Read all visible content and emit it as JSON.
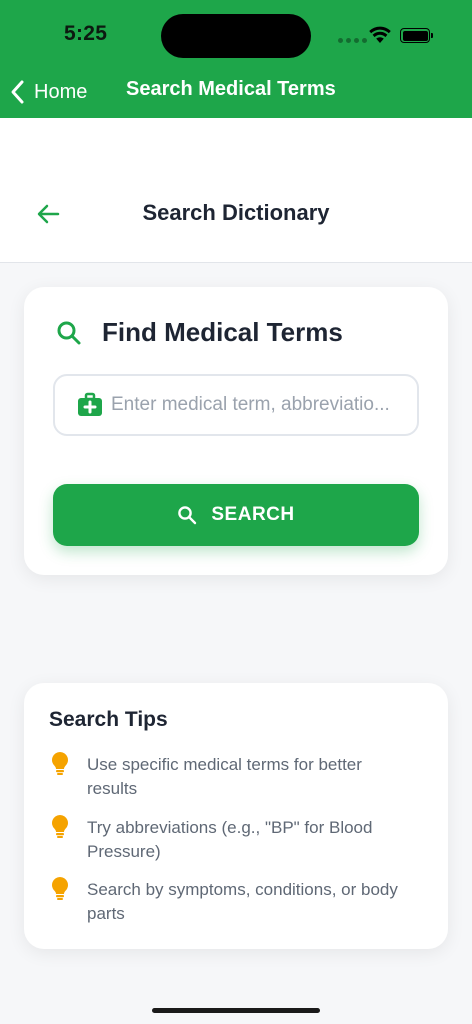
{
  "status_bar": {
    "time": "5:25"
  },
  "nav": {
    "back_label": "Home",
    "title": "Search Medical Terms"
  },
  "page": {
    "title": "Search Dictionary"
  },
  "search_card": {
    "title": "Find Medical Terms",
    "placeholder": "Enter medical term, abbreviatio...",
    "value": "",
    "button_label": "SEARCH"
  },
  "tips": {
    "title": "Search Tips",
    "items": [
      "Use specific medical terms for better results",
      "Try abbreviations (e.g., \"BP\" for Blood Pressure)",
      "Search by symptoms, conditions, or body parts"
    ]
  },
  "colors": {
    "brand_green": "#1ea64a",
    "tip_bulb": "#f5a300",
    "title_text": "#1e2533",
    "muted_text": "#5f6875"
  },
  "icons": {
    "nav_back": "chevron-left-icon",
    "page_back": "arrow-left-icon",
    "card_title": "search-icon",
    "field": "medical-kit-icon",
    "button": "search-icon",
    "tip": "lightbulb-icon"
  }
}
